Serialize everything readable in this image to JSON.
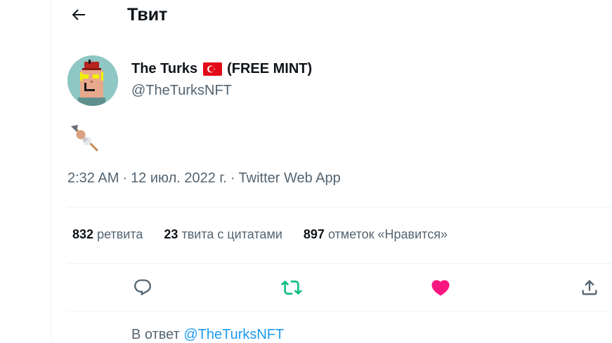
{
  "header": {
    "title": "Твит",
    "back_icon": "arrow-left-icon"
  },
  "tweet": {
    "author": {
      "name_part1": "The Turks",
      "flag_icon": "turkey-flag-icon",
      "name_part2": "(FREE MINT)",
      "handle": "@TheTurksNFT",
      "avatar_icon": "pixel-fez-avatar"
    },
    "content_emoji": "oden-skewer-emoji",
    "meta": {
      "time": "2:32 AM",
      "date": "12 июл. 2022 г.",
      "source": "Twitter Web App"
    },
    "stats": [
      {
        "count": "832",
        "label": "ретвита"
      },
      {
        "count": "23",
        "label": "твита с цитатами"
      },
      {
        "count": "897",
        "label": "отметок «Нравится»"
      }
    ],
    "actions": [
      {
        "icon": "reply-icon",
        "color": "#536471"
      },
      {
        "icon": "retweet-icon",
        "color": "#00ba7c"
      },
      {
        "icon": "like-icon",
        "color": "#f91880"
      },
      {
        "icon": "share-icon",
        "color": "#536471"
      }
    ],
    "reply_to": {
      "prefix": "В ответ",
      "mention": "@TheTurksNFT"
    }
  },
  "colors": {
    "text": "#0f1419",
    "muted": "#536471",
    "link": "#1d9bf0",
    "border": "#eff3f4"
  }
}
